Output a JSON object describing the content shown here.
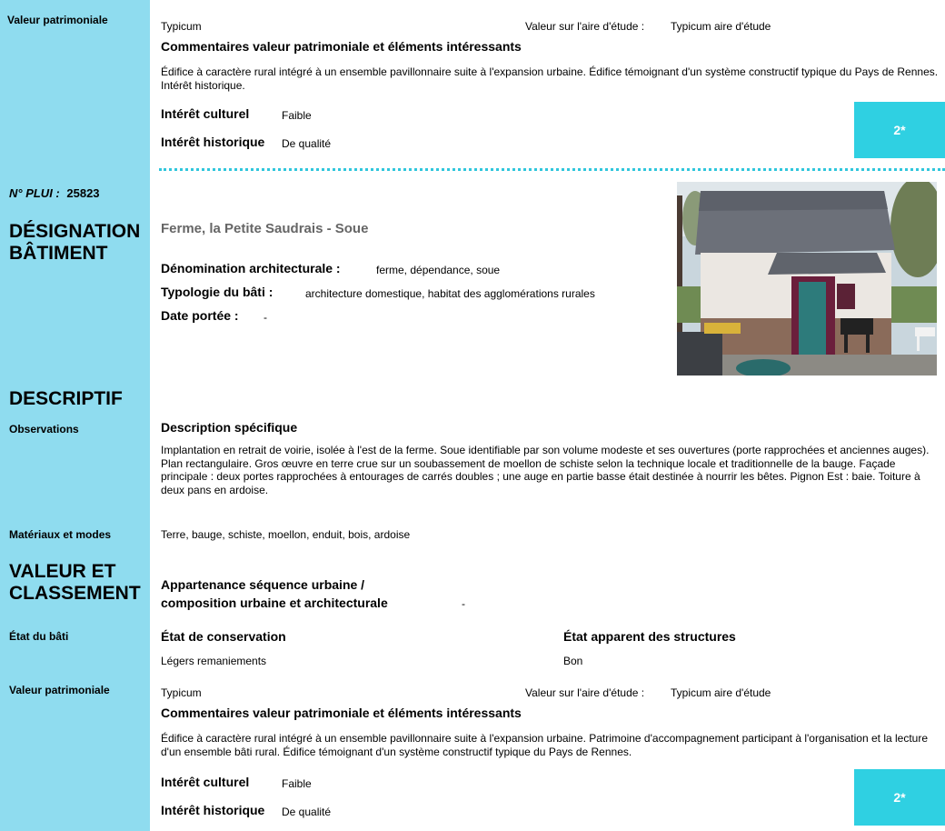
{
  "top_section": {
    "valeur_label": "Valeur patrimoniale",
    "valeur_value": "Typicum",
    "aire_label": "Valeur sur l'aire d'étude :",
    "aire_value": "Typicum aire d'étude",
    "commentaires_title": "Commentaires valeur patrimoniale et éléments intéressants",
    "commentaires_text": "Édifice à caractère rural intégré à un ensemble pavillonnaire suite à l'expansion urbaine. Édifice témoignant d'un système constructif typique du Pays de Rennes. Intérêt historique.",
    "interet_culturel_label": "Intérêt culturel",
    "interet_culturel_value": "Faible",
    "interet_historique_label": "Intérêt historique",
    "interet_historique_value": "De qualité",
    "badge": "2*"
  },
  "building": {
    "plui_label": "N° PLUI :",
    "plui_value": "25823",
    "designation_title": "DÉSIGNATION BÂTIMENT",
    "name": "Ferme, la Petite Saudrais - Soue",
    "denomination_label": "Dénomination architecturale :",
    "denomination_value": "ferme, dépendance, soue",
    "typologie_label": "Typologie du bâti :",
    "typologie_value": "architecture domestique, habitat des agglomérations rurales",
    "date_label": "Date portée :",
    "date_value": "-"
  },
  "descriptif": {
    "title": "DESCRIPTIF",
    "observations_label": "Observations",
    "description_title": "Description spécifique",
    "description_text": "Implantation en retrait de voirie, isolée à l'est de la ferme. Soue identifiable par son volume modeste et ses ouvertures (porte rapprochées et anciennes auges). Plan rectangulaire. Gros œuvre en terre crue sur un soubassement de moellon de schiste selon la technique locale et traditionnelle de la bauge. Façade principale : deux portes rapprochées à entourages de carrés doubles ; une auge en partie basse était destinée à nourrir les bêtes. Pignon Est : baie. Toiture à deux pans en ardoise.",
    "materiaux_label": "Matériaux et modes",
    "materiaux_value": "Terre, bauge, schiste, moellon, enduit, bois, ardoise"
  },
  "valeur_classement": {
    "title": "VALEUR ET CLASSEMENT",
    "appartenance_label": "Appartenance séquence urbaine / composition urbaine et architecturale",
    "appartenance_value": "-",
    "etat_label": "État du bâti",
    "conservation_title": "État de conservation",
    "conservation_value": "Légers remaniements",
    "structures_title": "État apparent des structures",
    "structures_value": "Bon",
    "valeur_label": "Valeur patrimoniale",
    "valeur_value": "Typicum",
    "aire_label": "Valeur sur l'aire d'étude :",
    "aire_value": "Typicum aire d'étude",
    "commentaires_title": "Commentaires valeur patrimoniale et éléments intéressants",
    "commentaires_text": "Édifice à caractère rural intégré à un ensemble pavillonnaire suite à l'expansion urbaine. Patrimoine d'accompagnement participant à l'organisation et la lecture d'un ensemble bâti rural. Édifice témoignant d'un système constructif typique du Pays de Rennes.",
    "interet_culturel_label": "Intérêt culturel",
    "interet_culturel_value": "Faible",
    "interet_historique_label": "Intérêt historique",
    "interet_historique_value": "De qualité",
    "badge": "2*"
  }
}
